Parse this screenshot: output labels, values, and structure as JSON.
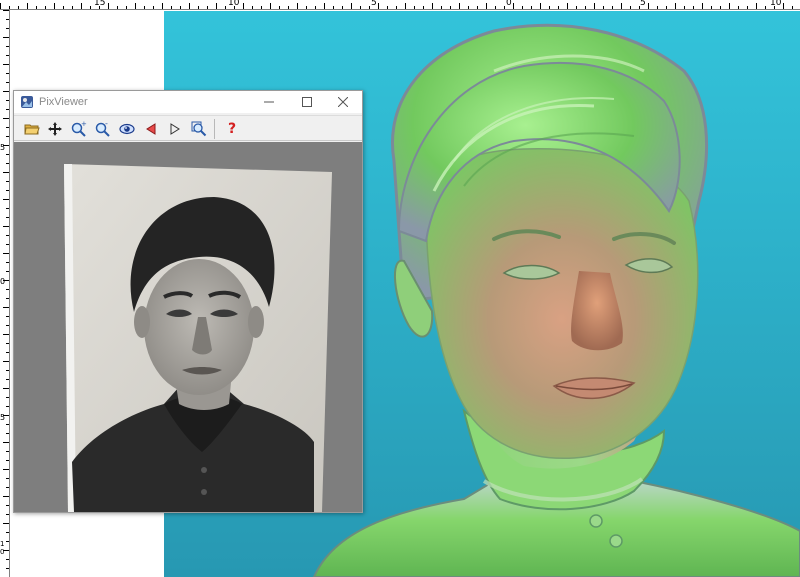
{
  "ruler": {
    "top_labels": [
      "15",
      "10",
      "5",
      "0",
      "5",
      "10"
    ],
    "left_labels": [
      "5",
      "0",
      "5",
      "10"
    ]
  },
  "pixviewer": {
    "title": "PixViewer",
    "toolbar": [
      {
        "name": "open-folder-icon",
        "tooltip": ""
      },
      {
        "name": "pan-move-icon",
        "tooltip": ""
      },
      {
        "name": "zoom-in-icon",
        "tooltip": ""
      },
      {
        "name": "zoom-out-icon",
        "tooltip": ""
      },
      {
        "name": "view-eye-icon",
        "tooltip": ""
      },
      {
        "name": "previous-arrow-icon",
        "tooltip": ""
      },
      {
        "name": "next-arrow-icon",
        "tooltip": ""
      },
      {
        "name": "zoom-fit-icon",
        "tooltip": ""
      },
      {
        "name": "help-icon",
        "tooltip": ""
      }
    ],
    "help_glyph": "?",
    "window_controls": {
      "minimize": "—",
      "maximize": "☐",
      "close": "✕"
    }
  },
  "colors": {
    "viewport_top": "#33c3da",
    "viewport_bottom": "#2798b2",
    "relief_green": "#7fd870",
    "relief_skin": "#c98a6a",
    "photo_bg": "#d9d6cf",
    "photo_dark": "#2a2a2a"
  }
}
